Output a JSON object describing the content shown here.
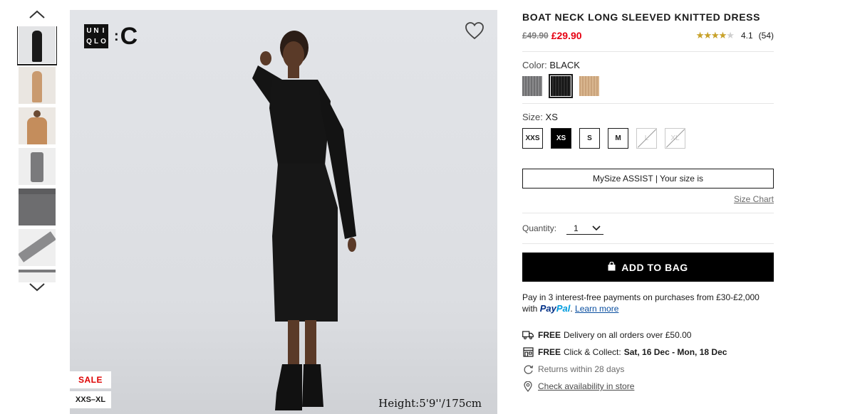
{
  "gallery": {
    "thumbnails": [
      {
        "name": "black dress full length",
        "tone": "#1a1a1a",
        "active": true
      },
      {
        "name": "beige dress full length",
        "tone": "#c99a6f",
        "active": false
      },
      {
        "name": "beige dress close-up",
        "tone": "#c48d5c",
        "active": false
      },
      {
        "name": "grey dress flat lay",
        "tone": "#7a7a7c",
        "active": false
      },
      {
        "name": "grey fabric detail",
        "tone": "#6d6d6f",
        "active": false
      },
      {
        "name": "grey sleeve detail",
        "tone": "#8b8b8d",
        "active": false
      }
    ],
    "icons": {
      "up": "chevron-up-icon",
      "down": "chevron-down-icon"
    }
  },
  "main_image": {
    "logo_left": [
      "U",
      "N",
      "I",
      "Q",
      "L",
      "O"
    ],
    "logo_right": "C",
    "sale_tag": "SALE",
    "size_range_tag": "XXS–XL",
    "height_caption": "Height:5'9''/175cm",
    "wishlist_icon": "heart-icon"
  },
  "product": {
    "title": "BOAT NECK LONG SLEEVED KNITTED DRESS",
    "price_original": "£49.90",
    "price_sale": "£29.90",
    "rating_value": "4.1",
    "rating_fraction": 0.82,
    "rating_count": "(54)",
    "stars_glyphs": "★★★★★"
  },
  "color": {
    "label": "Color:",
    "selected": "BLACK",
    "swatches": [
      {
        "name": "grey"
      },
      {
        "name": "black",
        "active": true
      },
      {
        "name": "beige"
      }
    ]
  },
  "size": {
    "label": "Size:",
    "selected": "XS",
    "options": [
      {
        "label": "XXS",
        "state": "available"
      },
      {
        "label": "XS",
        "state": "selected"
      },
      {
        "label": "S",
        "state": "available"
      },
      {
        "label": "M",
        "state": "available"
      },
      {
        "label": "L",
        "state": "unavailable"
      },
      {
        "label": "XL",
        "state": "unavailable"
      }
    ]
  },
  "mysize": {
    "button_label": "MySize ASSIST | Your size is",
    "size_chart_link": "Size Chart"
  },
  "quantity": {
    "label": "Quantity:",
    "value": "1"
  },
  "cart": {
    "add_label": "ADD TO BAG",
    "icon": "bag-icon"
  },
  "payment": {
    "text": "Pay in 3 interest-free payments on purchases from £30-£2,000",
    "with": "with",
    "paypal_a": "Pay",
    "paypal_b": "Pal",
    "learn_more": "Learn more"
  },
  "info": {
    "delivery_bold": "FREE",
    "delivery_text": "Delivery on all orders over £50.00",
    "collect_bold": "FREE",
    "collect_text": "Click & Collect:",
    "collect_dates": "Sat, 16 Dec - Mon, 18 Dec",
    "returns_text": "Returns within 28 days",
    "store_link": "Check availability in store"
  },
  "colors": {
    "sale_red": "#e60012",
    "star_gold": "#c9a227",
    "paypal_dark": "#003087",
    "paypal_light": "#009cde"
  }
}
